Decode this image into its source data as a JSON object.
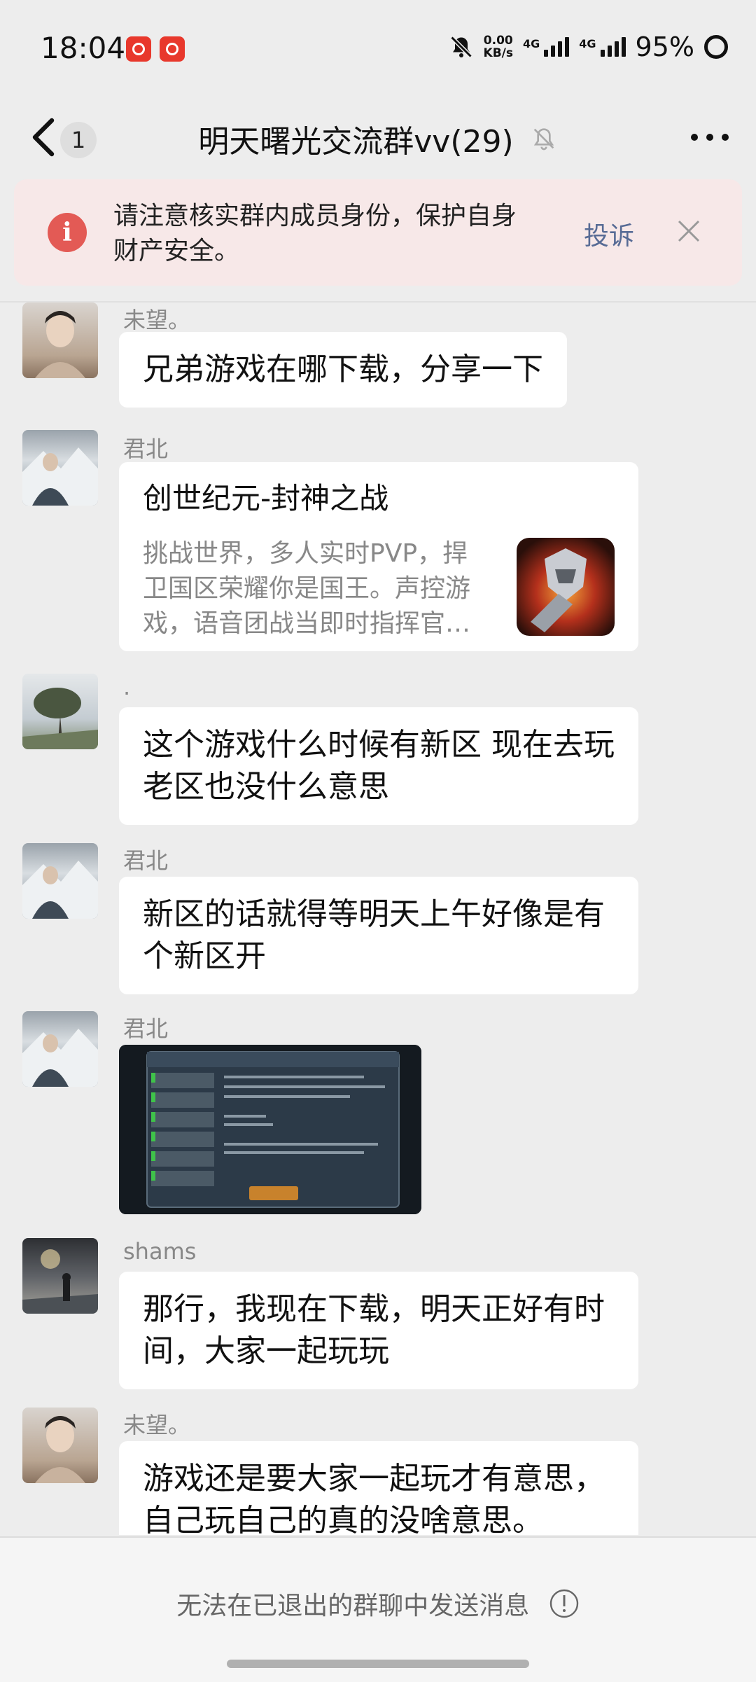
{
  "status_bar": {
    "time": "18:04",
    "net_speed_value": "0.00",
    "net_speed_unit": "KB/s",
    "sim1": "4G",
    "sim2": "4G",
    "battery": "95%"
  },
  "header": {
    "back_count": "1",
    "title": "明天曙光交流群vv(29)"
  },
  "notice": {
    "text": "请注意核实群内成员身份，保护自身财产安全。",
    "action": "投诉",
    "accent_color": "#e35a55"
  },
  "messages": [
    {
      "sender": "未望。",
      "text": "兄弟游戏在哪下载，分享一下"
    },
    {
      "sender": "君北",
      "card": {
        "title": "创世纪元-封神之战",
        "description": "挑战世界，多人实时PVP，捍卫国区荣耀你是国王。声控游戏，语音团战当即时指挥官…"
      }
    },
    {
      "sender": ".",
      "text": "这个游戏什么时候有新区 现在去玩老区也没什么意思"
    },
    {
      "sender": "君北",
      "text": "新区的话就得等明天上午好像是有个新区开"
    },
    {
      "sender": "君北",
      "image": "game-screenshot"
    },
    {
      "sender": "shams",
      "text": "那行，我现在下载，明天正好有时间，大家一起玩玩"
    },
    {
      "sender": "未望。",
      "text": "游戏还是要大家一起玩才有意思，自己玩自己的真的没啥意思。"
    }
  ],
  "footer": {
    "text": "无法在已退出的群聊中发送消息"
  },
  "colors": {
    "background": "#ededed",
    "bubble": "#ffffff",
    "link": "#576b95",
    "notice_bg": "#f7e8e8"
  }
}
